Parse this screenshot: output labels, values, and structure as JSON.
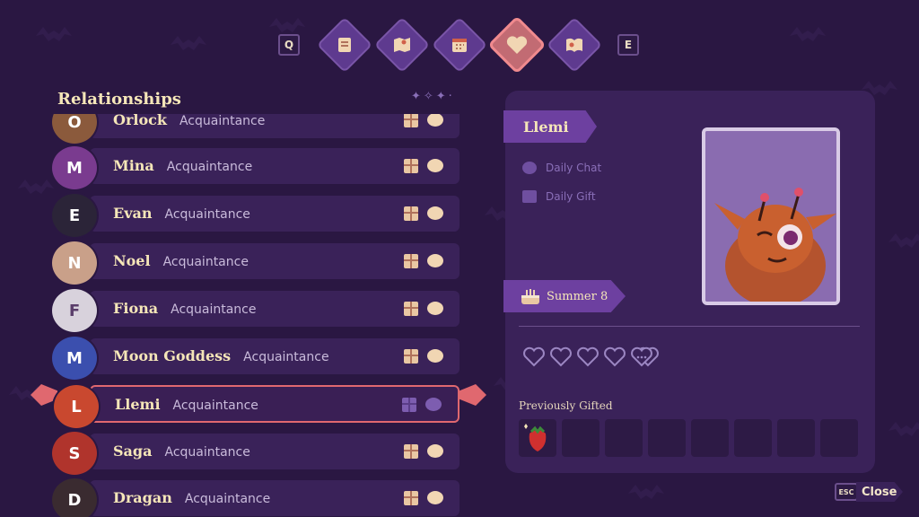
{
  "nav": {
    "prev_key": "Q",
    "next_key": "E",
    "tabs": [
      {
        "icon": "quest-scroll-icon",
        "active": false
      },
      {
        "icon": "map-icon",
        "active": false
      },
      {
        "icon": "calendar-icon",
        "active": false
      },
      {
        "icon": "heart-icon",
        "active": true
      },
      {
        "icon": "book-icon",
        "active": false
      }
    ]
  },
  "relationships": {
    "title": "Relationships",
    "rows": [
      {
        "name": "Orlock",
        "status": "Acquaintance",
        "avatar_color": "#8b5a3c",
        "selected": false
      },
      {
        "name": "Mina",
        "status": "Acquaintance",
        "avatar_color": "#7a3b8f",
        "selected": false
      },
      {
        "name": "Evan",
        "status": "Acquaintance",
        "avatar_color": "#2b2438",
        "selected": false
      },
      {
        "name": "Noel",
        "status": "Acquaintance",
        "avatar_color": "#c9a089",
        "selected": false
      },
      {
        "name": "Fiona",
        "status": "Acquaintance",
        "avatar_color": "#d8d2dc",
        "selected": false
      },
      {
        "name": "Moon Goddess",
        "status": "Acquaintance",
        "avatar_color": "#3b4fae",
        "selected": false
      },
      {
        "name": "Llemi",
        "status": "Acquaintance",
        "avatar_color": "#c9482f",
        "selected": true
      },
      {
        "name": "Saga",
        "status": "Acquaintance",
        "avatar_color": "#b0342c",
        "selected": false
      },
      {
        "name": "Dragan",
        "status": "Acquaintance",
        "avatar_color": "#3a2b30",
        "selected": false
      }
    ]
  },
  "detail": {
    "name": "Llemi",
    "daily_chat": "Daily Chat",
    "daily_gift": "Daily Gift",
    "birthday": "Summer 8",
    "hearts": 5,
    "previously_gifted_label": "Previously Gifted",
    "gift_slots": 8
  },
  "footer": {
    "close_key": "ESC",
    "close_label": "Close"
  },
  "colors": {
    "background": "#2a1742",
    "panel": "#3a2259",
    "accent": "#6d40a0",
    "selection": "#e0686f",
    "text_gold": "#f5e6b8"
  }
}
